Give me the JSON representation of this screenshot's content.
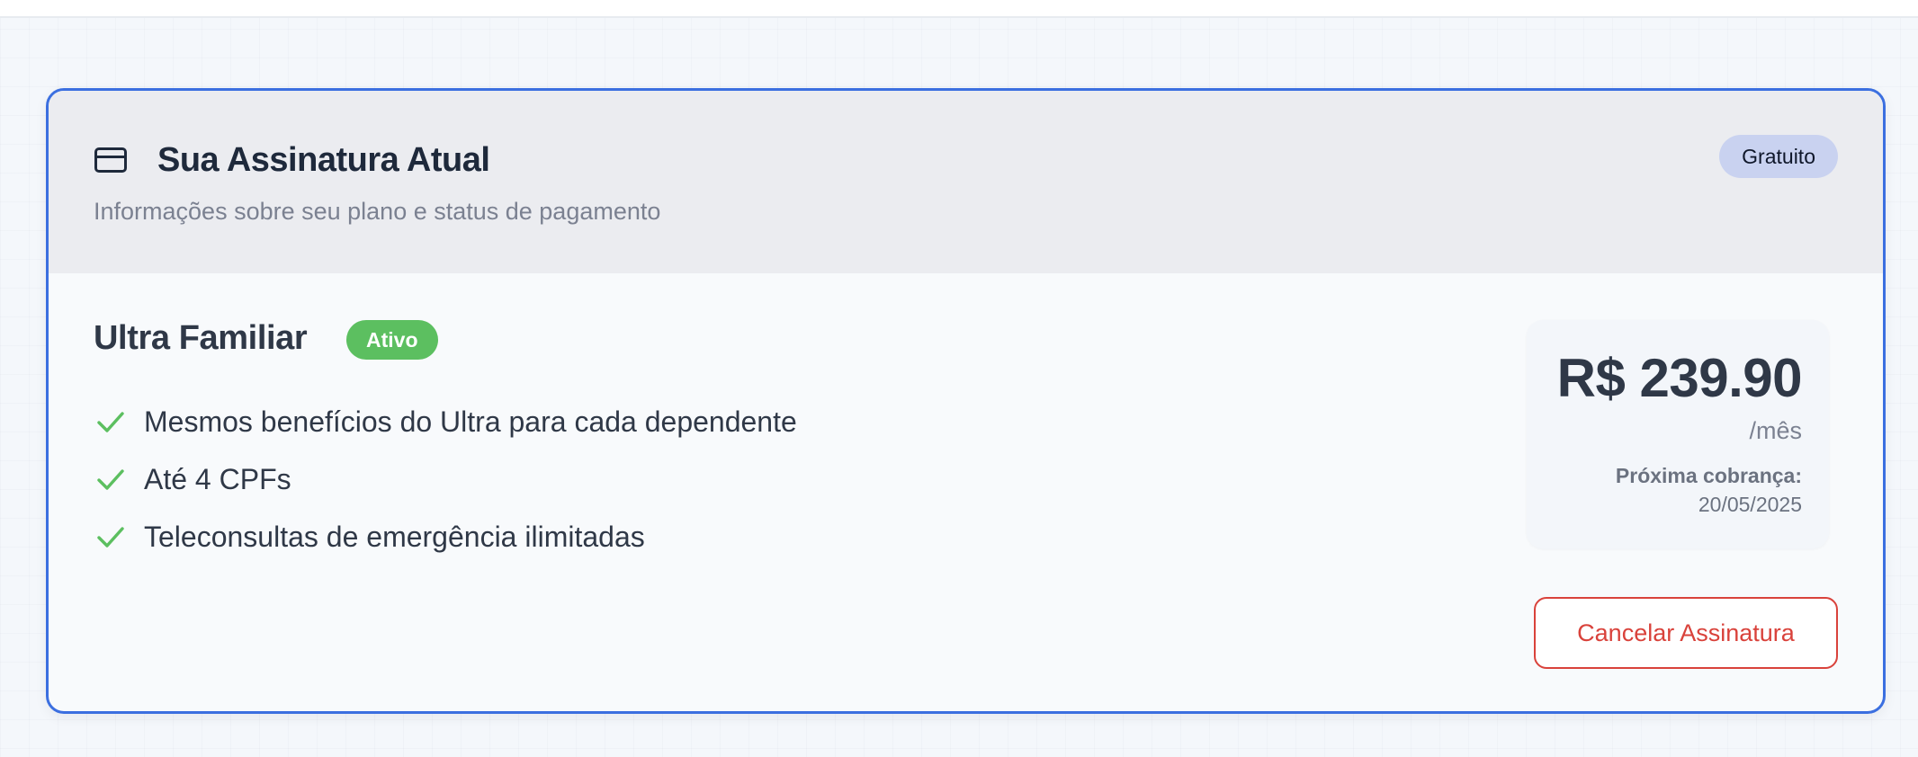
{
  "subscription_card": {
    "title": "Sua Assinatura Atual",
    "subtitle": "Informações sobre seu plano e status de pagamento",
    "plan_badge": "Gratuito",
    "card_icon": "credit-card-icon"
  },
  "plan": {
    "name": "Ultra Familiar",
    "status": "Ativo",
    "features": [
      "Mesmos benefícios do Ultra para cada dependente",
      "Até 4 CPFs",
      "Teleconsultas de emergência ilimitadas"
    ],
    "feature_icon": "check-icon"
  },
  "billing": {
    "price": "R$ 239.90",
    "period": "/mês",
    "next_charge_label": "Próxima cobrança:",
    "next_charge_date": "20/05/2025"
  },
  "actions": {
    "cancel_label": "Cancelar Assinatura"
  },
  "colors": {
    "accent_border": "#3b6fe0",
    "status_active": "#5cbf60",
    "plan_badge_bg": "#c9d2f0",
    "danger": "#d9423b",
    "check": "#5cbf60"
  }
}
